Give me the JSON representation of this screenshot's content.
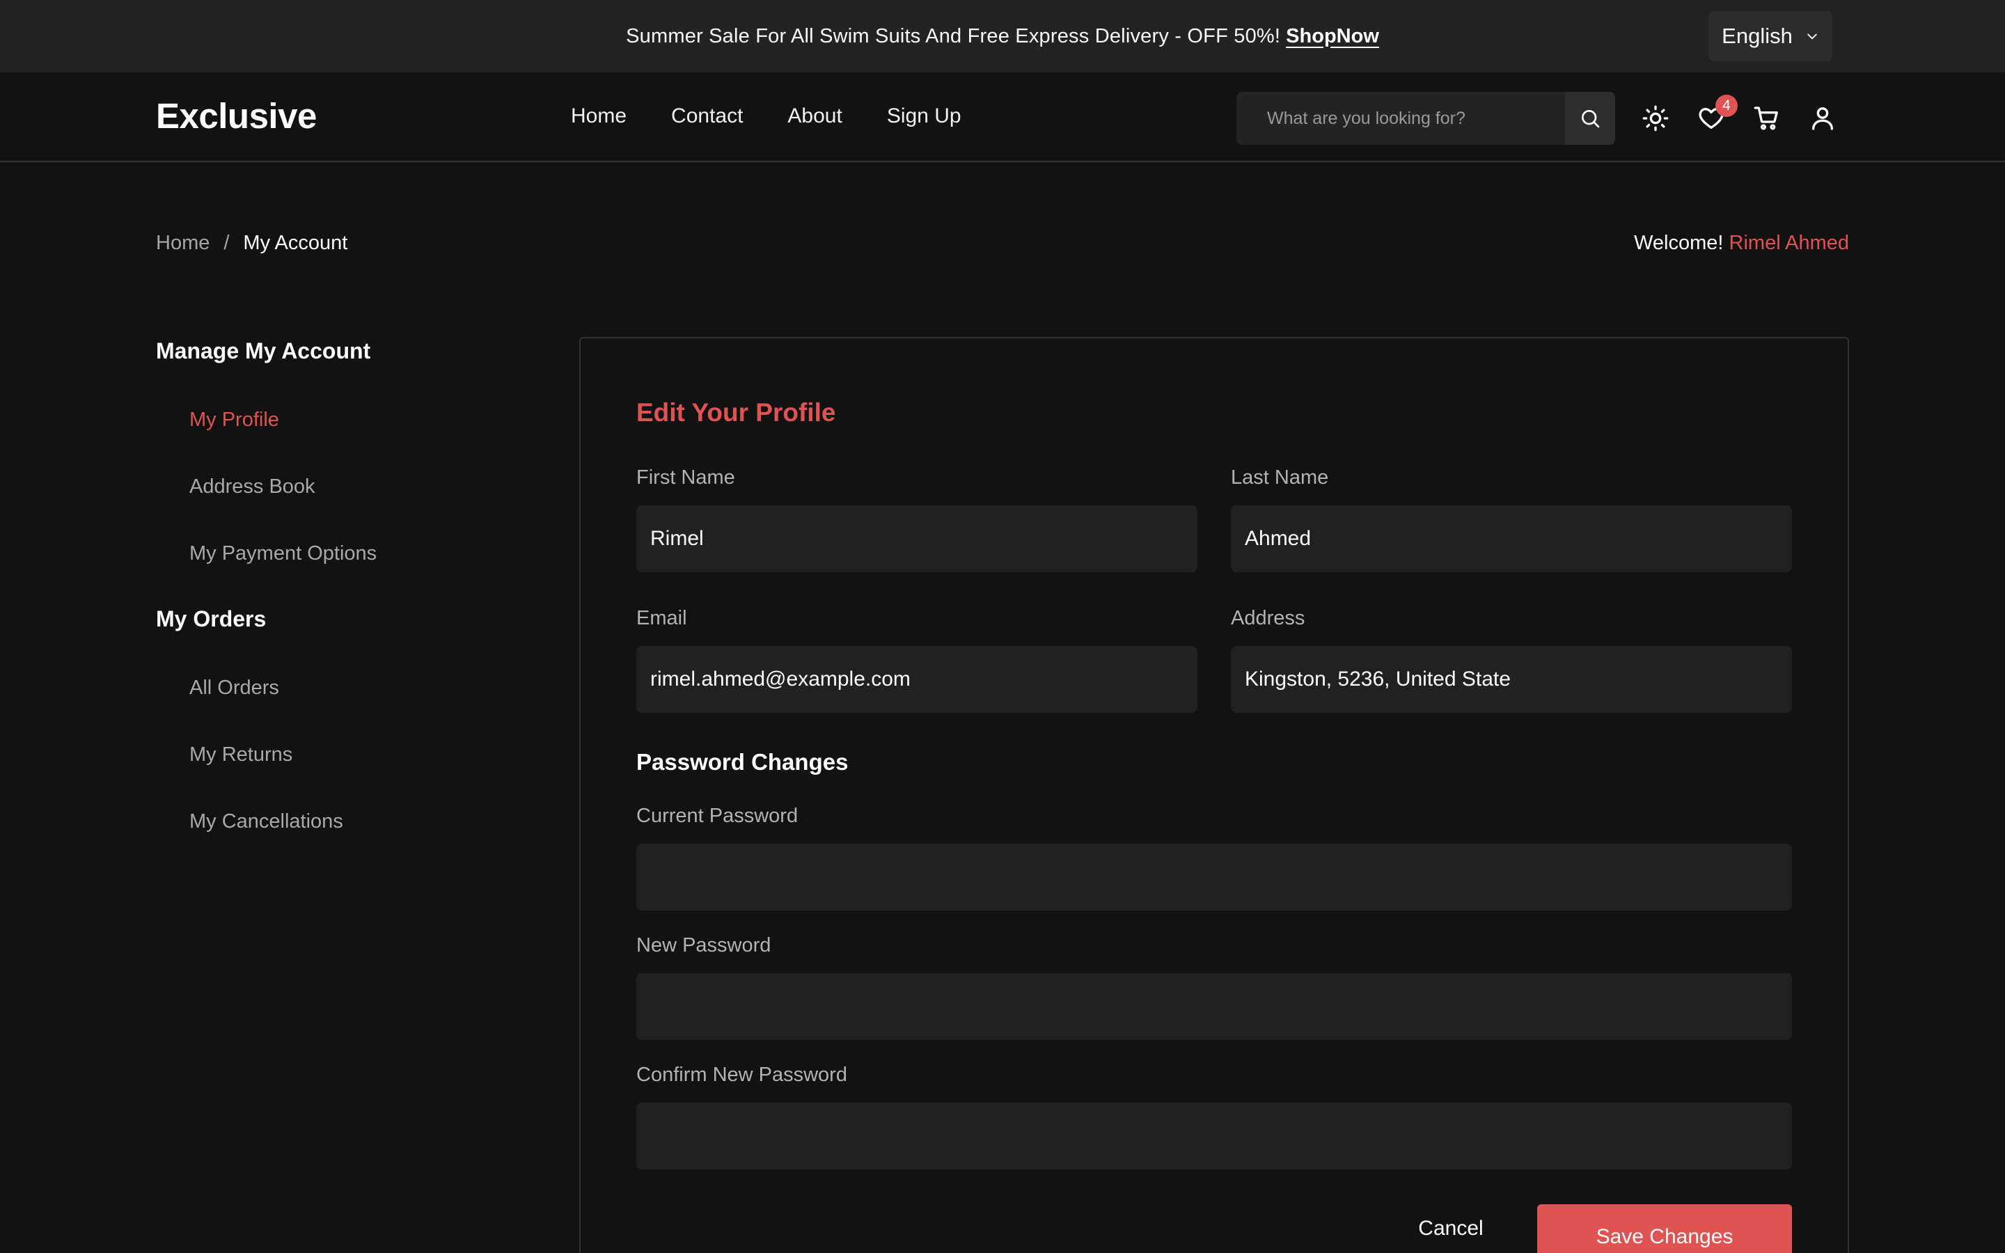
{
  "topbar": {
    "text": "Summer Sale For All Swim Suits And Free Express Delivery - OFF 50%!",
    "link": "ShopNow",
    "language": "English"
  },
  "header": {
    "logo": "Exclusive",
    "nav": [
      "Home",
      "Contact",
      "About",
      "Sign Up"
    ],
    "search_placeholder": "What are you looking for?",
    "wishlist_count": "4",
    "icons": [
      "theme-sun-icon",
      "heart-icon",
      "cart-icon",
      "user-icon",
      "search-icon",
      "chevron-down-icon"
    ]
  },
  "breadcrumb": {
    "home": "Home",
    "separator": "/",
    "current": "My Account"
  },
  "welcome": {
    "prefix": "Welcome!",
    "name": "Rimel Ahmed"
  },
  "sidebar": {
    "account_heading": "Manage My Account",
    "account_items": [
      "My Profile",
      "Address Book",
      "My Payment Options"
    ],
    "active_item": "My Profile",
    "orders_heading": "My Orders",
    "orders_items": [
      "All Orders",
      "My Returns",
      "My Cancellations"
    ]
  },
  "form": {
    "title": "Edit Your Profile",
    "first_name_label": "First Name",
    "first_name": "Rimel",
    "last_name_label": "Last Name",
    "last_name": "Ahmed",
    "email_label": "Email",
    "email": "rimel.ahmed@example.com",
    "address_label": "Address",
    "address": "Kingston, 5236, United State",
    "password_section": "Password Changes",
    "current_password_label": "Current Password",
    "new_password_label": "New Password",
    "confirm_password_label": "Confirm New Password",
    "cancel": "Cancel",
    "save": "Save Changes"
  },
  "colors": {
    "accent": "#e05353",
    "background": "#121212",
    "topbar": "#232323",
    "input": "#212121"
  }
}
